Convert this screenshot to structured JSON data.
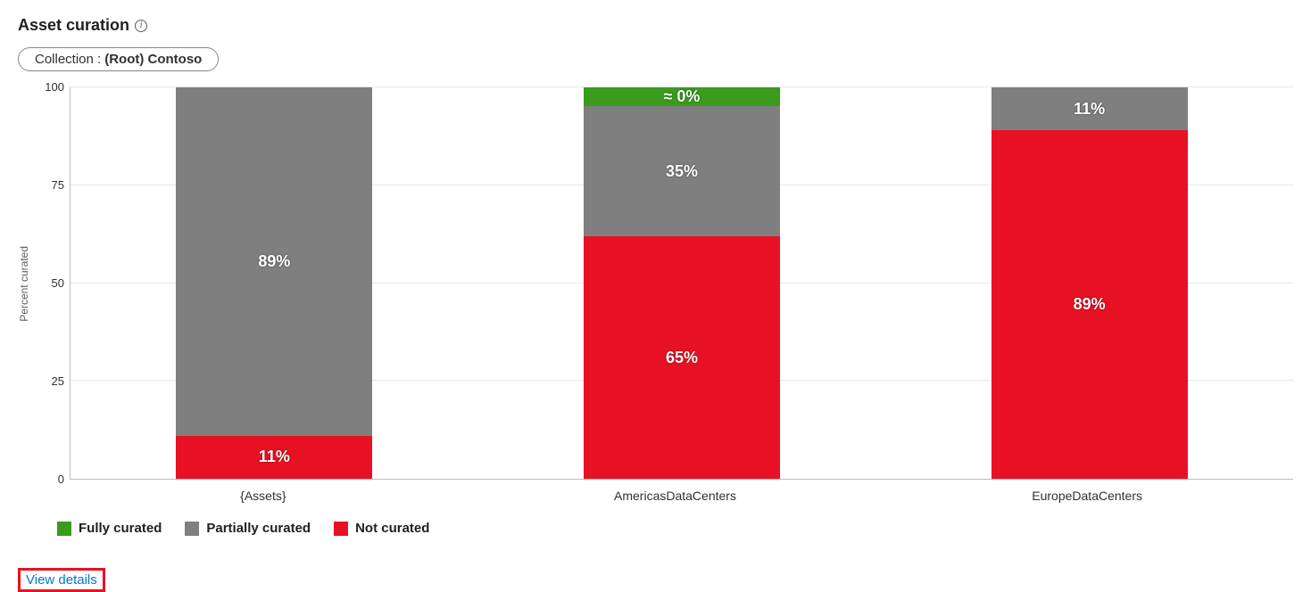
{
  "title": "Asset curation",
  "filter": {
    "label": "Collection :",
    "value": "(Root) Contoso"
  },
  "legend": {
    "fully": "Fully curated",
    "partially": "Partially curated",
    "not": "Not curated"
  },
  "links": {
    "view_details": "View details"
  },
  "colors": {
    "fully": "#3a9b1c",
    "partially": "#7f7f7f",
    "not": "#e81123",
    "link": "#0078d4"
  },
  "chart_data": {
    "type": "bar",
    "stacked": true,
    "ylabel": "Percent curated",
    "xlabel": "",
    "ylim": [
      0,
      100
    ],
    "yticks": [
      0,
      25,
      50,
      75,
      100
    ],
    "categories": [
      "{Assets}",
      "AmericasDataCenters",
      "EuropeDataCenters"
    ],
    "series": [
      {
        "name": "Not curated",
        "color": "#e81123",
        "values": [
          11,
          65,
          89
        ],
        "labels": [
          "11%",
          "65%",
          "89%"
        ]
      },
      {
        "name": "Partially curated",
        "color": "#7f7f7f",
        "values": [
          89,
          35,
          11
        ],
        "labels": [
          "89%",
          "35%",
          "11%"
        ]
      },
      {
        "name": "Fully curated",
        "color": "#3a9b1c",
        "values": [
          0,
          0,
          0
        ],
        "labels": [
          "",
          "≈ 0%",
          ""
        ],
        "displayHeights": [
          0,
          5,
          0
        ]
      }
    ]
  }
}
